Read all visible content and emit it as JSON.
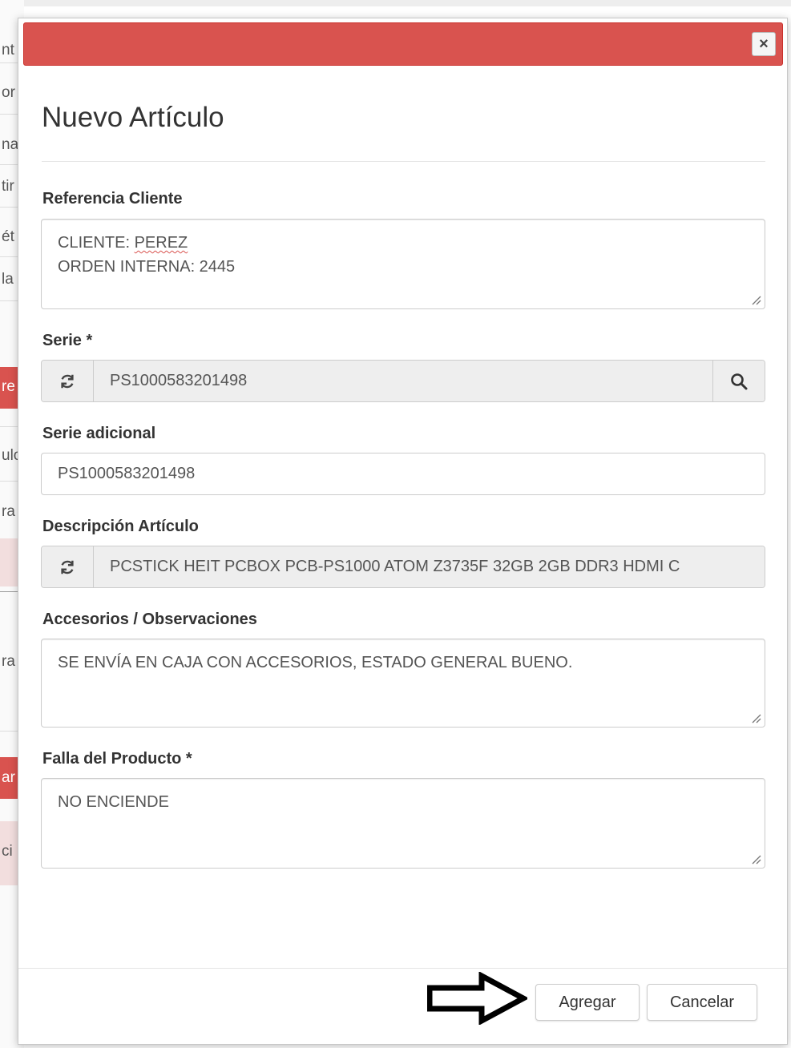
{
  "background": {
    "fragments": [
      "nt",
      "or",
      "na",
      "tir",
      "ét",
      "la",
      "re",
      "ulo",
      "ra",
      "ra",
      "ar",
      "ci"
    ]
  },
  "modal": {
    "title": "Nuevo Artículo",
    "close_symbol": "×",
    "header_color": "#d9534f"
  },
  "form": {
    "referencia": {
      "label": "Referencia Cliente",
      "line1_prefix": "CLIENTE: ",
      "line1_word": "PEREZ",
      "line2": "ORDEN INTERNA: 2445"
    },
    "serie": {
      "label": "Serie *",
      "value": "PS1000583201498",
      "refresh_icon": "refresh-icon",
      "search_icon": "search-icon"
    },
    "serie_adicional": {
      "label": "Serie adicional",
      "value": "PS1000583201498"
    },
    "descripcion": {
      "label": "Descripción Artículo",
      "value": "PCSTICK HEIT PCBOX PCB-PS1000 ATOM Z3735F 32GB 2GB DDR3 HDMI C"
    },
    "accesorios": {
      "label": "Accesorios / Observaciones",
      "value": "SE ENVÍA EN CAJA CON ACCESORIOS, ESTADO GENERAL BUENO."
    },
    "falla": {
      "label": "Falla del Producto *",
      "value": "NO ENCIENDE"
    }
  },
  "footer": {
    "add_label": "Agregar",
    "cancel_label": "Cancelar",
    "annotation_icon": "arrow-right-icon"
  }
}
